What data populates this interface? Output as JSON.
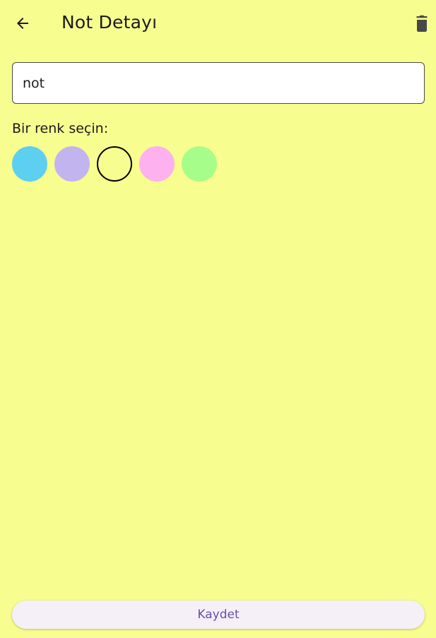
{
  "appbar": {
    "title": "Not Detayı",
    "back_icon": "arrow-left-icon",
    "delete_icon": "trash-icon"
  },
  "note_field": {
    "value": "not"
  },
  "color_picker": {
    "label": "Bir renk seçin:",
    "options": [
      {
        "name": "blue",
        "color": "#5dcff1",
        "selected": false
      },
      {
        "name": "lavender",
        "color": "#c2b5ef",
        "selected": false
      },
      {
        "name": "yellow",
        "color": "#f8fd8f",
        "selected": true
      },
      {
        "name": "pink",
        "color": "#fdb1ee",
        "selected": false
      },
      {
        "name": "green",
        "color": "#a7fd89",
        "selected": false
      }
    ]
  },
  "save_button": {
    "label": "Kaydet"
  },
  "colors": {
    "background": "#f8fd8f",
    "accent": "#6750a4"
  }
}
